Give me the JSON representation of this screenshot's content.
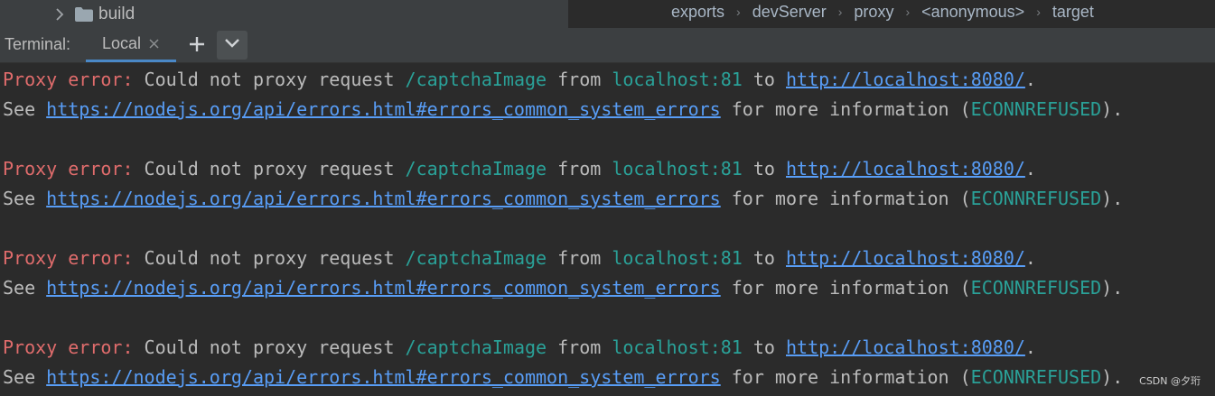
{
  "project_tree": {
    "folder_label": "build",
    "chevron_icon": "chevron-right-icon",
    "folder_icon": "folder-icon"
  },
  "breadcrumb": {
    "items": [
      "exports",
      "devServer",
      "proxy",
      "<anonymous>",
      "target"
    ],
    "separator": "›"
  },
  "terminal": {
    "title": "Terminal:",
    "tab_label": "Local",
    "close_icon": "close-icon",
    "add_icon": "plus-icon",
    "menu_icon": "chevron-down-icon"
  },
  "output": {
    "blocks": [
      {
        "line1": {
          "prefix": "Proxy error:",
          "text1": " Could not proxy request ",
          "path": "/captchaImage",
          "text2": " from ",
          "host": "localhost:81",
          "text3": " to ",
          "url": "http://localhost:8080/",
          "end": "."
        },
        "line2": {
          "see": "See ",
          "link": "https://nodejs.org/api/errors.html#errors_common_system_errors",
          "text": " for more information (",
          "code": "ECONNREFUSED",
          "end": ")."
        }
      },
      {
        "line1": {
          "prefix": "Proxy error:",
          "text1": " Could not proxy request ",
          "path": "/captchaImage",
          "text2": " from ",
          "host": "localhost:81",
          "text3": " to ",
          "url": "http://localhost:8080/",
          "end": "."
        },
        "line2": {
          "see": "See ",
          "link": "https://nodejs.org/api/errors.html#errors_common_system_errors",
          "text": " for more information (",
          "code": "ECONNREFUSED",
          "end": ")."
        }
      },
      {
        "line1": {
          "prefix": "Proxy error:",
          "text1": " Could not proxy request ",
          "path": "/captchaImage",
          "text2": " from ",
          "host": "localhost:81",
          "text3": " to ",
          "url": "http://localhost:8080/",
          "end": "."
        },
        "line2": {
          "see": "See ",
          "link": "https://nodejs.org/api/errors.html#errors_common_system_errors",
          "text": " for more information (",
          "code": "ECONNREFUSED",
          "end": ")."
        }
      },
      {
        "line1": {
          "prefix": "Proxy error:",
          "text1": " Could not proxy request ",
          "path": "/captchaImage",
          "text2": " from ",
          "host": "localhost:81",
          "text3": " to ",
          "url": "http://localhost:8080/",
          "end": "."
        },
        "line2": {
          "see": "See ",
          "link": "https://nodejs.org/api/errors.html#errors_common_system_errors",
          "text": " for more information (",
          "code": "ECONNREFUSED",
          "end": ")."
        }
      }
    ]
  },
  "watermark": "CSDN @夕珩",
  "colors": {
    "background": "#2b2b2b",
    "panel": "#3c3f41",
    "error_red": "#e06c6c",
    "teal": "#2aa198",
    "link_blue": "#589df6",
    "text": "#bbbbbb",
    "tab_underline": "#4a88c7"
  }
}
